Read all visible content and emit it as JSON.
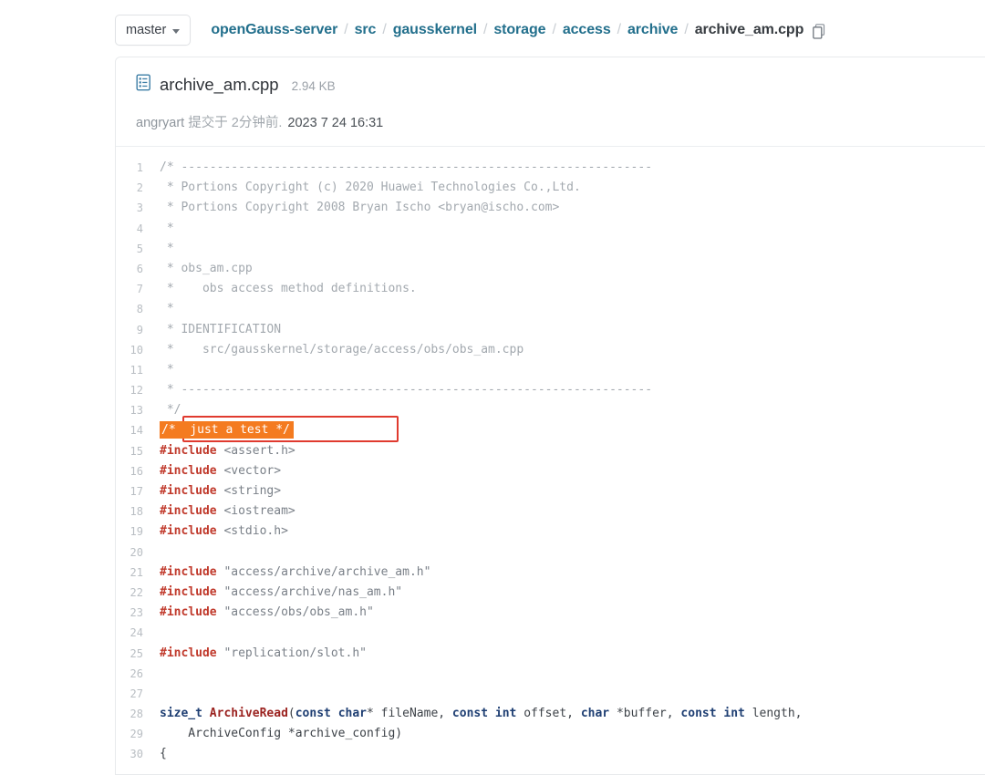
{
  "breadcrumb": {
    "branch_label": "master",
    "segments": [
      {
        "label": "openGauss-server",
        "current": false
      },
      {
        "label": "src",
        "current": false
      },
      {
        "label": "gausskernel",
        "current": false
      },
      {
        "label": "storage",
        "current": false
      },
      {
        "label": "access",
        "current": false
      },
      {
        "label": "archive",
        "current": false
      },
      {
        "label": "archive_am.cpp",
        "current": true
      }
    ],
    "separator": "/",
    "copy_icon": "copy-icon"
  },
  "file": {
    "icon": "file-document-icon",
    "name": "archive_am.cpp",
    "size": "2.94 KB",
    "commit_author": "angryart",
    "commit_text": "提交于",
    "commit_relative": "2分钟前",
    "commit_dot": ".",
    "commit_date": "2023 7 24 16:31",
    "collapse_icon": "minus-icon"
  },
  "colors": {
    "link": "#226f8c",
    "highlight_bg": "#f47b20",
    "highlight_border": "#e03a2f",
    "keyword": "#1f3f73",
    "preprocessor": "#c0392b",
    "comment": "#a3a9af"
  },
  "code": {
    "lines": [
      {
        "n": "1",
        "tokens": [
          {
            "t": "/* ------------------------------------------------------------------",
            "c": "cmt"
          }
        ]
      },
      {
        "n": "2",
        "tokens": [
          {
            "t": " * Portions Copyright (c) 2020 Huawei Technologies Co.,Ltd.",
            "c": "cmt"
          }
        ]
      },
      {
        "n": "3",
        "tokens": [
          {
            "t": " * Portions Copyright 2008 Bryan Ischo <bryan@ischo.com>",
            "c": "cmt"
          }
        ]
      },
      {
        "n": "4",
        "tokens": [
          {
            "t": " *",
            "c": "cmt"
          }
        ]
      },
      {
        "n": "5",
        "tokens": [
          {
            "t": " *",
            "c": "cmt"
          }
        ]
      },
      {
        "n": "6",
        "tokens": [
          {
            "t": " * obs_am.cpp",
            "c": "cmt"
          }
        ]
      },
      {
        "n": "7",
        "tokens": [
          {
            "t": " *    obs access method definitions.",
            "c": "cmt"
          }
        ]
      },
      {
        "n": "8",
        "tokens": [
          {
            "t": " *",
            "c": "cmt"
          }
        ]
      },
      {
        "n": "9",
        "tokens": [
          {
            "t": " * IDENTIFICATION",
            "c": "cmt"
          }
        ]
      },
      {
        "n": "10",
        "tokens": [
          {
            "t": " *    src/gausskernel/storage/access/obs/obs_am.cpp",
            "c": "cmt"
          }
        ]
      },
      {
        "n": "11",
        "tokens": [
          {
            "t": " *",
            "c": "cmt"
          }
        ]
      },
      {
        "n": "12",
        "tokens": [
          {
            "t": " * ------------------------------------------------------------------",
            "c": "cmt"
          }
        ]
      },
      {
        "n": "13",
        "tokens": [
          {
            "t": " */",
            "c": "cmt"
          }
        ]
      },
      {
        "n": "14",
        "highlight": true,
        "tokens": [
          {
            "t": "/*  just a test */",
            "c": "hl-text"
          }
        ]
      },
      {
        "n": "15",
        "tokens": [
          {
            "t": "#include",
            "c": "pre"
          },
          {
            "t": " <assert.h>",
            "c": "str"
          }
        ]
      },
      {
        "n": "16",
        "tokens": [
          {
            "t": "#include",
            "c": "pre"
          },
          {
            "t": " <vector>",
            "c": "str"
          }
        ]
      },
      {
        "n": "17",
        "tokens": [
          {
            "t": "#include",
            "c": "pre"
          },
          {
            "t": " <string>",
            "c": "str"
          }
        ]
      },
      {
        "n": "18",
        "tokens": [
          {
            "t": "#include",
            "c": "pre"
          },
          {
            "t": " <iostream>",
            "c": "str"
          }
        ]
      },
      {
        "n": "19",
        "tokens": [
          {
            "t": "#include",
            "c": "pre"
          },
          {
            "t": " <stdio.h>",
            "c": "str"
          }
        ]
      },
      {
        "n": "20",
        "tokens": [
          {
            "t": "",
            "c": "pl"
          }
        ]
      },
      {
        "n": "21",
        "tokens": [
          {
            "t": "#include",
            "c": "pre"
          },
          {
            "t": " \"access/archive/archive_am.h\"",
            "c": "str"
          }
        ]
      },
      {
        "n": "22",
        "tokens": [
          {
            "t": "#include",
            "c": "pre"
          },
          {
            "t": " \"access/archive/nas_am.h\"",
            "c": "str"
          }
        ]
      },
      {
        "n": "23",
        "tokens": [
          {
            "t": "#include",
            "c": "pre"
          },
          {
            "t": " \"access/obs/obs_am.h\"",
            "c": "str"
          }
        ]
      },
      {
        "n": "24",
        "tokens": [
          {
            "t": "",
            "c": "pl"
          }
        ]
      },
      {
        "n": "25",
        "tokens": [
          {
            "t": "#include",
            "c": "pre"
          },
          {
            "t": " \"replication/slot.h\"",
            "c": "str"
          }
        ]
      },
      {
        "n": "26",
        "tokens": [
          {
            "t": "",
            "c": "pl"
          }
        ]
      },
      {
        "n": "27",
        "tokens": [
          {
            "t": "",
            "c": "pl"
          }
        ]
      },
      {
        "n": "28",
        "tokens": [
          {
            "t": "size_t",
            "c": "kw"
          },
          {
            "t": " ",
            "c": "pl"
          },
          {
            "t": "ArchiveRead",
            "c": "fn"
          },
          {
            "t": "(",
            "c": "pl"
          },
          {
            "t": "const",
            "c": "kw"
          },
          {
            "t": " ",
            "c": "pl"
          },
          {
            "t": "char",
            "c": "kw"
          },
          {
            "t": "* fileName, ",
            "c": "pl"
          },
          {
            "t": "const",
            "c": "kw"
          },
          {
            "t": " ",
            "c": "pl"
          },
          {
            "t": "int",
            "c": "kw"
          },
          {
            "t": " offset, ",
            "c": "pl"
          },
          {
            "t": "char",
            "c": "kw"
          },
          {
            "t": " *buffer, ",
            "c": "pl"
          },
          {
            "t": "const",
            "c": "kw"
          },
          {
            "t": " ",
            "c": "pl"
          },
          {
            "t": "int",
            "c": "kw"
          },
          {
            "t": " length,",
            "c": "pl"
          }
        ]
      },
      {
        "n": "29",
        "tokens": [
          {
            "t": "    ArchiveConfig *archive_config)",
            "c": "pl"
          }
        ]
      },
      {
        "n": "30",
        "tokens": [
          {
            "t": "{",
            "c": "pl"
          }
        ]
      }
    ]
  }
}
